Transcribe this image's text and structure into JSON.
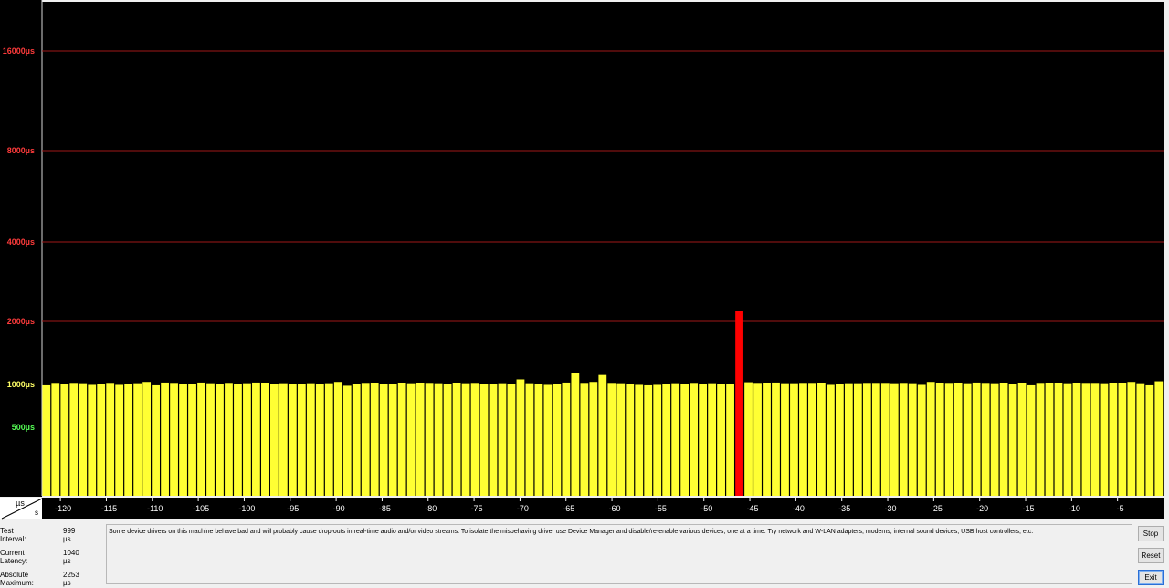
{
  "chart_data": {
    "type": "bar",
    "y_ticks": [
      {
        "label": "16000µs",
        "value": 16000,
        "color": "#ff3b3b"
      },
      {
        "label": "8000µs",
        "value": 8000,
        "color": "#ff3b3b"
      },
      {
        "label": "4000µs",
        "value": 4000,
        "color": "#ff3b3b"
      },
      {
        "label": "2000µs",
        "value": 2000,
        "color": "#ff3b3b"
      },
      {
        "label": "1000µs",
        "value": 1000,
        "color": "#ffff66"
      },
      {
        "label": "500µs",
        "value": 500,
        "color": "#55ff55"
      }
    ],
    "x_ticks": [
      "-120",
      "-115",
      "-110",
      "-105",
      "-100",
      "-95",
      "-90",
      "-85",
      "-80",
      "-75",
      "-70",
      "-65",
      "-60",
      "-55",
      "-50",
      "-45",
      "-40",
      "-35",
      "-30",
      "-25",
      "-20",
      "-15",
      "-10",
      "-5"
    ],
    "x_range": [
      -122,
      0
    ],
    "corner_labels": {
      "top": "µs",
      "bottom": "s"
    },
    "bar_color": "#ffff33",
    "highlight_color": "#ff0000",
    "grid_color": "#a01818",
    "values": [
      990,
      1010,
      1000,
      1010,
      1005,
      995,
      1000,
      1010,
      995,
      1000,
      1005,
      1040,
      990,
      1030,
      1010,
      1000,
      1000,
      1030,
      1005,
      1000,
      1010,
      1000,
      1005,
      1030,
      1015,
      1000,
      1005,
      1000,
      1000,
      1005,
      1000,
      1005,
      1040,
      985,
      1000,
      1010,
      1020,
      1000,
      1000,
      1015,
      1005,
      1025,
      1010,
      1005,
      1000,
      1020,
      1005,
      1010,
      1000,
      1000,
      1005,
      1000,
      1080,
      1005,
      1000,
      995,
      1000,
      1030,
      1180,
      1010,
      1040,
      1150,
      1010,
      1005,
      1000,
      995,
      990,
      995,
      1000,
      1005,
      1000,
      1010,
      1000,
      1005,
      1000,
      1000,
      2253,
      1035,
      1010,
      1020,
      1030,
      1005,
      1005,
      1010,
      1010,
      1020,
      995,
      1000,
      1005,
      1005,
      1010,
      1010,
      1010,
      1005,
      1010,
      1005,
      995,
      1040,
      1020,
      1010,
      1020,
      1005,
      1030,
      1010,
      1005,
      1020,
      1000,
      1020,
      990,
      1010,
      1020,
      1020,
      1005,
      1015,
      1010,
      1010,
      1005,
      1020,
      1020,
      1040,
      1005,
      990,
      1050
    ],
    "highlight_index": 76
  },
  "status": {
    "test_interval_label": "Test Interval:",
    "test_interval_value": "999 µs",
    "current_latency_label": "Current Latency:",
    "current_latency_value": "1040 µs",
    "absolute_maximum_label": "Absolute Maximum:",
    "absolute_maximum_value": "2253 µs"
  },
  "message": "Some device drivers on this machine behave bad and will probably cause drop-outs in real-time audio and/or video streams. To isolate the misbehaving driver use Device Manager and disable/re-enable various devices, one at a time. Try network and W-LAN adapters, modems, internal sound devices, USB host controllers, etc.",
  "buttons": {
    "stop": "Stop",
    "reset": "Reset",
    "exit": "Exit"
  }
}
